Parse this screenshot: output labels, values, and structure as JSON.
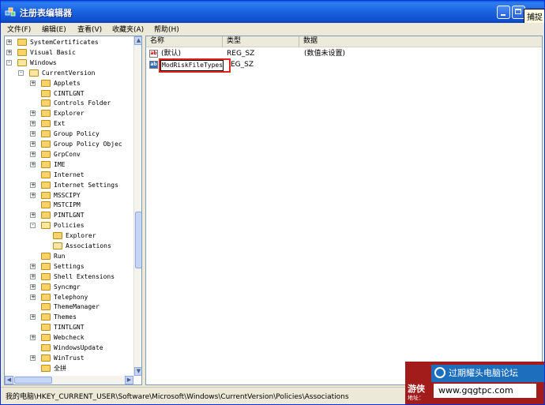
{
  "window": {
    "title": "注册表编辑器"
  },
  "tooltip": "捕捉",
  "menu": [
    {
      "label": "文件(F)"
    },
    {
      "label": "编辑(E)"
    },
    {
      "label": "查看(V)"
    },
    {
      "label": "收藏夹(A)"
    },
    {
      "label": "帮助(H)"
    }
  ],
  "tree": [
    {
      "label": "SystemCertificates",
      "expander": "+"
    },
    {
      "label": "Visual Basic",
      "expander": "+"
    },
    {
      "label": "Windows",
      "expander": "-"
    },
    {
      "label": "CurrentVersion",
      "expander": "-"
    },
    {
      "label": "Applets",
      "expander": "+"
    },
    {
      "label": "CINTLGNT",
      "expander": ""
    },
    {
      "label": "Controls Folder",
      "expander": ""
    },
    {
      "label": "Explorer",
      "expander": "+"
    },
    {
      "label": "Ext",
      "expander": "+"
    },
    {
      "label": "Group Policy",
      "expander": "+"
    },
    {
      "label": "Group Policy Objec",
      "expander": "+"
    },
    {
      "label": "GrpConv",
      "expander": "+"
    },
    {
      "label": "IME",
      "expander": "+"
    },
    {
      "label": "Internet",
      "expander": ""
    },
    {
      "label": "Internet Settings",
      "expander": "+"
    },
    {
      "label": "MSSCIPY",
      "expander": "+"
    },
    {
      "label": "MSTCIPM",
      "expander": ""
    },
    {
      "label": "PINTLGNT",
      "expander": "+"
    },
    {
      "label": "Policies",
      "expander": "-"
    },
    {
      "label": "Explorer",
      "expander": ""
    },
    {
      "label": "Associations",
      "expander": ""
    },
    {
      "label": "Run",
      "expander": ""
    },
    {
      "label": "Settings",
      "expander": "+"
    },
    {
      "label": "Shell Extensions",
      "expander": "+"
    },
    {
      "label": "Syncmgr",
      "expander": "+"
    },
    {
      "label": "Telephony",
      "expander": "+"
    },
    {
      "label": "ThemeManager",
      "expander": ""
    },
    {
      "label": "Themes",
      "expander": "+"
    },
    {
      "label": "TINTLGNT",
      "expander": ""
    },
    {
      "label": "Webcheck",
      "expander": "+"
    },
    {
      "label": "WindowsUpdate",
      "expander": ""
    },
    {
      "label": "WinTrust",
      "expander": "+"
    },
    {
      "label": "全拼",
      "expander": ""
    }
  ],
  "columns": {
    "name": "名称",
    "type": "类型",
    "data": "数据"
  },
  "values": [
    {
      "name": "(默认)",
      "type": "REG_SZ",
      "data": "(数值未设置)"
    },
    {
      "name": "ModRiskFileTypes",
      "type": "REG_SZ",
      "data": ""
    }
  ],
  "edit_type_visible": "EG_SZ",
  "status": "我的电脑\\HKEY_CURRENT_USER\\Software\\Microsoft\\Windows\\CurrentVersion\\Policies\\Associations",
  "watermark": {
    "forum": "过期耀头电脑论坛",
    "logo": "游侠",
    "sub": "地址：",
    "url": "www.gqgtpc.com"
  }
}
